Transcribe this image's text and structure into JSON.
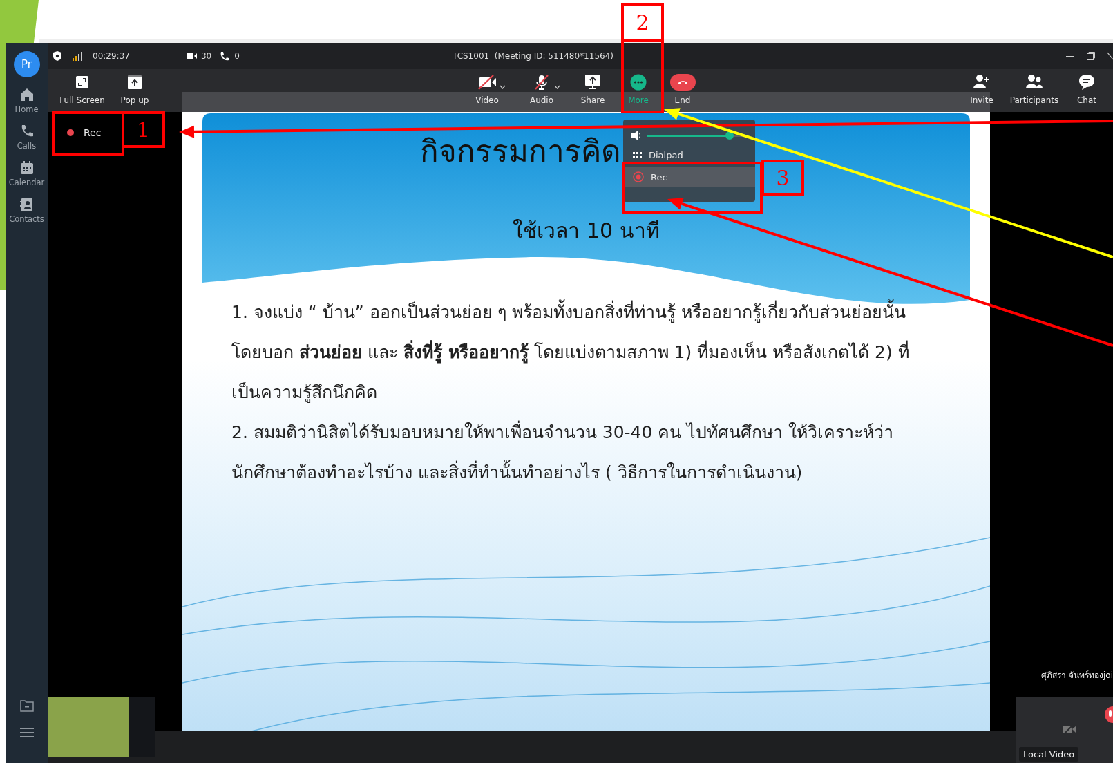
{
  "window": {
    "title": "TCS1001  (Meeting ID: 511480*11564)"
  },
  "status": {
    "duration": "00:29:37",
    "video_count": "30",
    "call_count": "0"
  },
  "rail": {
    "avatar": "Pr",
    "items": [
      {
        "label": "Home"
      },
      {
        "label": "Calls"
      },
      {
        "label": "Calendar"
      },
      {
        "label": "Contacts"
      }
    ]
  },
  "toolbar": {
    "left": [
      {
        "label": "Full Screen"
      },
      {
        "label": "Pop up"
      }
    ],
    "center": [
      {
        "label": "Video",
        "selected": false
      },
      {
        "label": "Audio",
        "selected": false
      },
      {
        "label": "Share",
        "selected": false
      },
      {
        "label": "More",
        "selected": true
      },
      {
        "label": "End",
        "selected": false
      }
    ],
    "right": [
      {
        "label": "Invite"
      },
      {
        "label": "Participants"
      },
      {
        "label": "Chat"
      }
    ]
  },
  "recording": {
    "label": "Rec"
  },
  "menu": {
    "volume": {
      "level": 0.86
    },
    "items": [
      {
        "label": "Dialpad",
        "selected": false
      },
      {
        "label": "Rec",
        "selected": true
      }
    ]
  },
  "slide": {
    "title": "กิจกรรมการคิด",
    "subtitle": "ใช้เวลา 10 นาที",
    "paragraphs": [
      "1. จงแบ่ง “ บ้าน” ออกเป็นส่วนย่อย ๆ พร้อมทั้งบอกสิ่งที่ท่านรู้ หรืออยากรู้เกี่ยวกับส่วนย่อยนั้น โดยบอก **ส่วนย่อย** และ **สิ่งที่รู้ หรืออยากรู้** โดยแบ่งตามสภาพ 1) ที่มองเห็น หรือสังเกตได้ 2) ที่เป็นความรู้สึกนึกคิด",
      "2. สมมติว่านิสิตได้รับมอบหมายให้พาเพื่อนจำนวน 30-40 คน ไปทัศนศึกษา ให้วิเคราะห์ว่านักศึกษาต้องทำอะไรบ้าง และสิ่งที่ทำนั้นทำอย่างไร ( วิธีการในการดำเนินงาน)"
    ]
  },
  "participant": {
    "name": "ศุภิสรา จันทร์ทองjoi"
  },
  "local_video": {
    "label": "Local Video"
  },
  "annotations": {
    "labels": [
      "1",
      "2",
      "3"
    ],
    "arrows": [
      {
        "color": "#ff0000"
      },
      {
        "color": "#ffff00"
      },
      {
        "color": "#ff0000"
      }
    ]
  }
}
